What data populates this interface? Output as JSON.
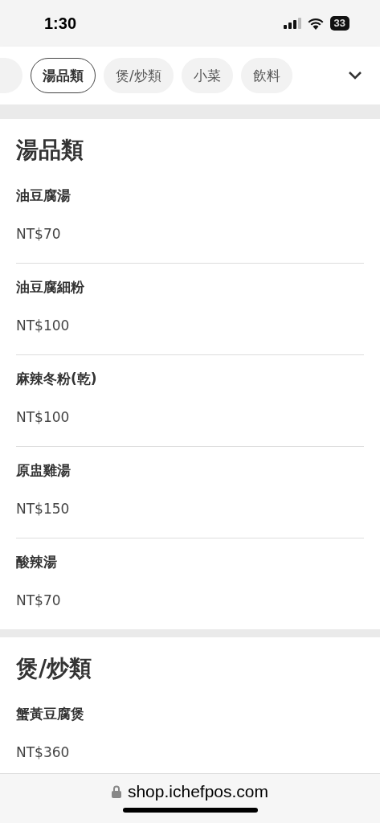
{
  "status_bar": {
    "time": "1:30",
    "battery": "33"
  },
  "tabs": [
    {
      "label": "湯品類",
      "selected": true
    },
    {
      "label": "煲/炒類",
      "selected": false
    },
    {
      "label": "小菜",
      "selected": false
    },
    {
      "label": "飲料",
      "selected": false
    }
  ],
  "sections": [
    {
      "title": "湯品類",
      "items": [
        {
          "name": "油豆腐湯",
          "price": "NT$70"
        },
        {
          "name": "油豆腐細粉",
          "price": "NT$100"
        },
        {
          "name": "麻辣冬粉(乾)",
          "price": "NT$100"
        },
        {
          "name": "原盅雞湯",
          "price": "NT$150"
        },
        {
          "name": "酸辣湯",
          "price": "NT$70"
        }
      ]
    },
    {
      "title": "煲/炒類",
      "items": [
        {
          "name": "蟹黃豆腐煲",
          "price": "NT$360"
        }
      ]
    }
  ],
  "address_bar": {
    "url": "shop.ichefpos.com"
  }
}
